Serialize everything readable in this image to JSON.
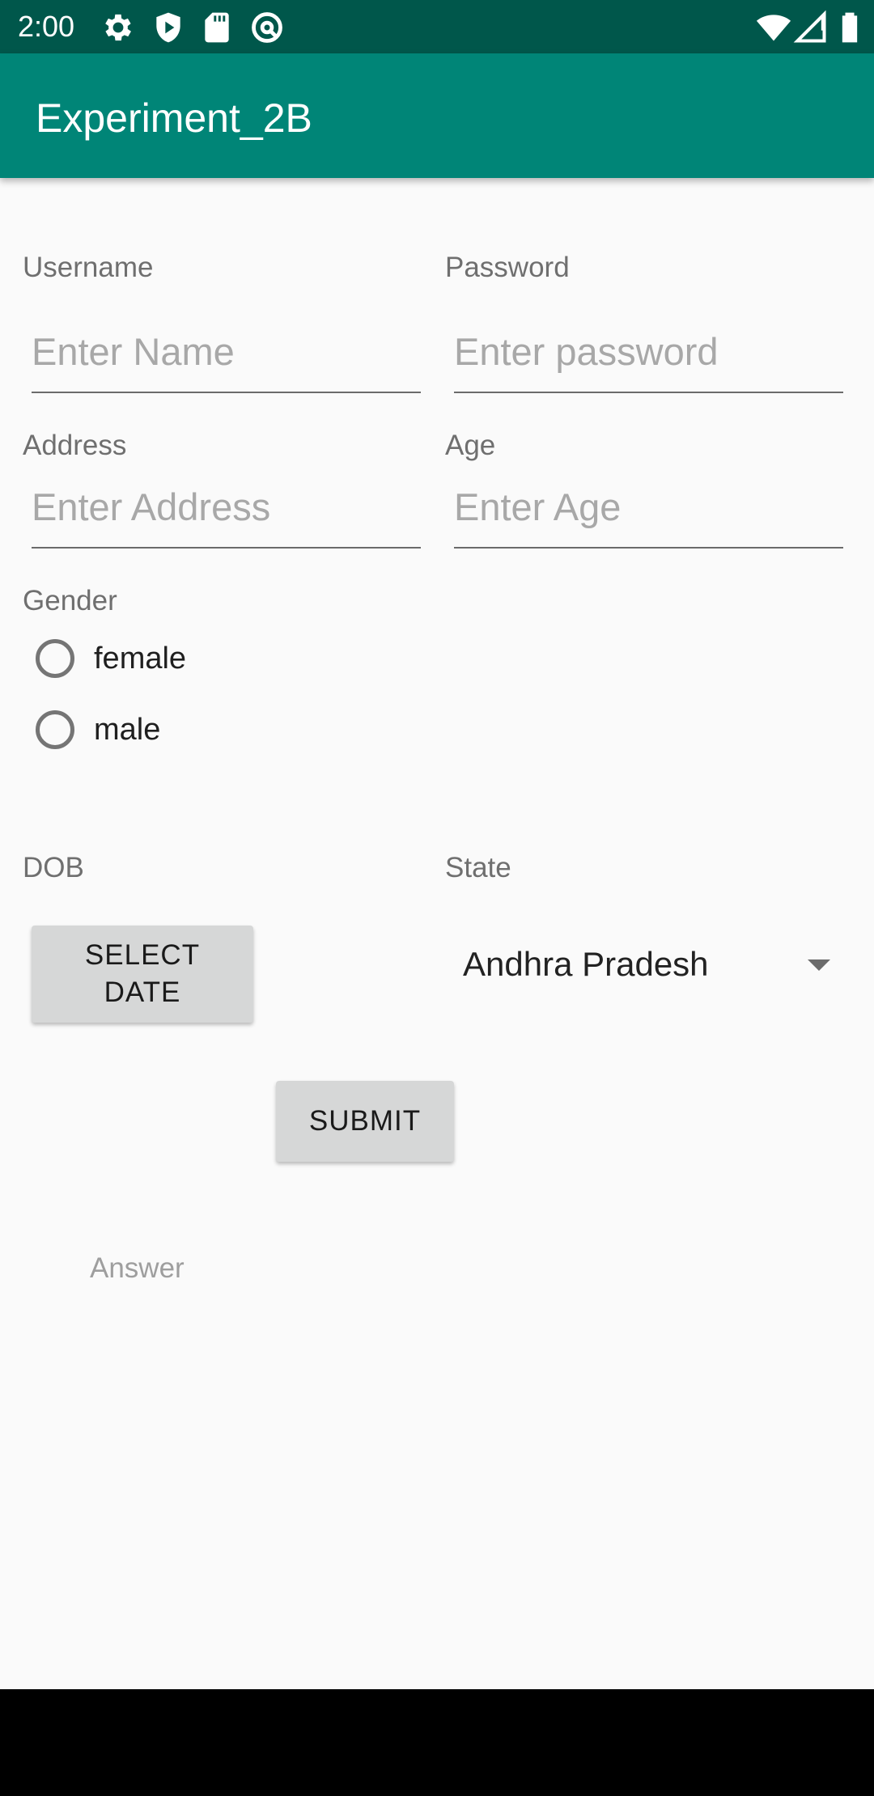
{
  "status_bar": {
    "time": "2:00",
    "left_icons": [
      "settings-icon",
      "shield-icon",
      "sd-card-icon",
      "at-sign-icon"
    ],
    "right_icons": [
      "wifi-icon",
      "signal-icon",
      "battery-icon"
    ]
  },
  "app_bar": {
    "title": "Experiment_2B",
    "color": "#008577",
    "status_color": "#00574B"
  },
  "form": {
    "username": {
      "label": "Username",
      "placeholder": "Enter Name",
      "value": ""
    },
    "password": {
      "label": "Password",
      "placeholder": "Enter password",
      "value": ""
    },
    "address": {
      "label": "Address",
      "placeholder": "Enter Address",
      "value": ""
    },
    "age": {
      "label": "Age",
      "placeholder": "Enter Age",
      "value": ""
    },
    "gender": {
      "label": "Gender",
      "options": [
        {
          "label": "female",
          "checked": false
        },
        {
          "label": "male",
          "checked": false
        }
      ]
    },
    "dob": {
      "label": "DOB",
      "button_label": "SELECT DATE"
    },
    "state": {
      "label": "State",
      "selected": "Andhra Pradesh"
    },
    "submit_label": "SUBMIT",
    "answer": "Answer"
  }
}
